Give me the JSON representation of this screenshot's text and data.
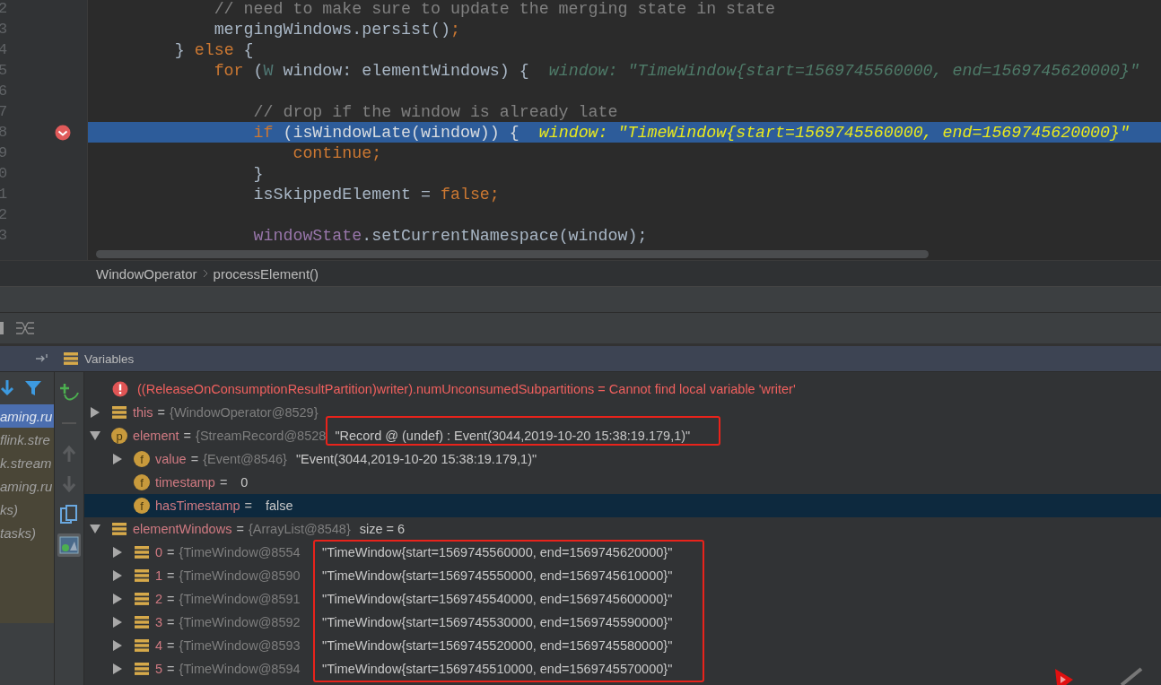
{
  "editor": {
    "lines": [
      {
        "number": "2",
        "current": false,
        "breakpoint": false,
        "tokens": [
          {
            "kind": "comment",
            "text": "            // need to make sure to update the merging state in state"
          }
        ]
      },
      {
        "number": "3",
        "current": false,
        "breakpoint": false,
        "tokens": [
          {
            "kind": "plain",
            "text": "            mergingWindows.persist()"
          },
          {
            "kind": "keyword",
            "text": ";"
          }
        ]
      },
      {
        "number": "4",
        "current": false,
        "breakpoint": false,
        "tokens": [
          {
            "kind": "plain",
            "text": "        } "
          },
          {
            "kind": "keyword",
            "text": "else"
          },
          {
            "kind": "plain",
            "text": " {"
          }
        ]
      },
      {
        "number": "5",
        "current": false,
        "breakpoint": false,
        "tokens": [
          {
            "kind": "keyword",
            "text": "            for"
          },
          {
            "kind": "plain",
            "text": " ("
          },
          {
            "kind": "type",
            "text": "W"
          },
          {
            "kind": "plain",
            "text": " window: elementWindows) {"
          }
        ],
        "hint": "window: \"TimeWindow{start=1569745560000, end=1569745620000}\""
      },
      {
        "number": "6",
        "current": false,
        "breakpoint": false
      },
      {
        "number": "7",
        "current": false,
        "breakpoint": false,
        "tokens": [
          {
            "kind": "comment",
            "text": "                // drop if the window is already late"
          }
        ]
      },
      {
        "number": "8",
        "current": true,
        "breakpoint": true,
        "tokens": [
          {
            "kind": "keyword",
            "text": "                if"
          },
          {
            "kind": "plain",
            "text": " (isWindowLate(window)) {"
          }
        ],
        "hint": "window: \"TimeWindow{start=1569745560000, end=1569745620000}\""
      },
      {
        "number": "9",
        "current": false,
        "breakpoint": false,
        "tokens": [
          {
            "kind": "keyword",
            "text": "                    continue;"
          }
        ]
      },
      {
        "number": "0",
        "current": false,
        "breakpoint": false,
        "tokens": [
          {
            "kind": "plain",
            "text": "                }"
          }
        ]
      },
      {
        "number": "1",
        "current": false,
        "breakpoint": false,
        "tokens": [
          {
            "kind": "plain",
            "text": "                isSkippedElement = "
          },
          {
            "kind": "keyword",
            "text": "false;"
          }
        ]
      },
      {
        "number": "2",
        "current": false,
        "breakpoint": false
      },
      {
        "number": "3",
        "current": false,
        "breakpoint": false,
        "tokens": [
          {
            "kind": "field",
            "text": "                windowState"
          },
          {
            "kind": "plain",
            "text": ".setCurrentNamespace(window);"
          }
        ]
      }
    ]
  },
  "breadcrumbs": [
    "WindowOperator",
    "processElement()"
  ],
  "variables_panel": {
    "title": "Variables"
  },
  "frames": [
    {
      "text": "aming.ru",
      "selected": true
    },
    {
      "text": "flink.stre",
      "selected": false
    },
    {
      "text": "k.stream",
      "selected": false
    },
    {
      "text": "aming.ru",
      "selected": false
    },
    {
      "text": "ks)",
      "selected": false
    },
    {
      "text": "tasks)",
      "selected": false
    }
  ],
  "variables": [
    {
      "kind": "error",
      "text": "((ReleaseOnConsumptionResultPartition)writer).numUnconsumedSubpartitions = Cannot find local variable 'writer'",
      "selected": false
    },
    {
      "kind": "object",
      "name": "this",
      "separator": "=",
      "type": "{WindowOperator@8529}",
      "expanded": false,
      "selected": false
    },
    {
      "kind": "param",
      "badge": "p",
      "name": "element",
      "separator": "=",
      "type": "{StreamRecord@8528",
      "value": "\"Record @ (undef) : Event(3044,2019-10-20 15:38:19.179,1)\"",
      "highlighted": true,
      "expanded": true,
      "selected": false,
      "children": [
        {
          "kind": "field",
          "badge": "f",
          "name": "value",
          "separator": "=",
          "type": "{Event@8546}",
          "value": "\"Event(3044,2019-10-20 15:38:19.179,1)\"",
          "expanded": false,
          "selected": false
        },
        {
          "kind": "field",
          "badge": "f",
          "name": "timestamp",
          "separator": "=",
          "value": "0",
          "selected": false
        },
        {
          "kind": "field",
          "badge": "f",
          "name": "hasTimestamp",
          "separator": "=",
          "value": "false",
          "selected": true
        }
      ]
    },
    {
      "kind": "object",
      "name": "elementWindows",
      "separator": "=",
      "type": "{ArrayList@8548}",
      "value": "size = 6",
      "expanded": true,
      "selected": false,
      "children_highlighted": true,
      "children": [
        {
          "kind": "object",
          "name": "0",
          "separator": "=",
          "type": "{TimeWindow@8554",
          "value": "\"TimeWindow{start=1569745560000, end=1569745620000}\"",
          "expanded": false,
          "selected": false
        },
        {
          "kind": "object",
          "name": "1",
          "separator": "=",
          "type": "{TimeWindow@8590",
          "value": "\"TimeWindow{start=1569745550000, end=1569745610000}\"",
          "expanded": false,
          "selected": false
        },
        {
          "kind": "object",
          "name": "2",
          "separator": "=",
          "type": "{TimeWindow@8591",
          "value": "\"TimeWindow{start=1569745540000, end=1569745600000}\"",
          "expanded": false,
          "selected": false
        },
        {
          "kind": "object",
          "name": "3",
          "separator": "=",
          "type": "{TimeWindow@8592",
          "value": "\"TimeWindow{start=1569745530000, end=1569745590000}\"",
          "expanded": false,
          "selected": false
        },
        {
          "kind": "object",
          "name": "4",
          "separator": "=",
          "type": "{TimeWindow@8593",
          "value": "\"TimeWindow{start=1569745520000, end=1569745580000}\"",
          "expanded": false,
          "selected": false
        },
        {
          "kind": "object",
          "name": "5",
          "separator": "=",
          "type": "{TimeWindow@8594",
          "value": "\"TimeWindow{start=1569745510000, end=1569745570000}\"",
          "expanded": false,
          "selected": false
        }
      ]
    }
  ]
}
